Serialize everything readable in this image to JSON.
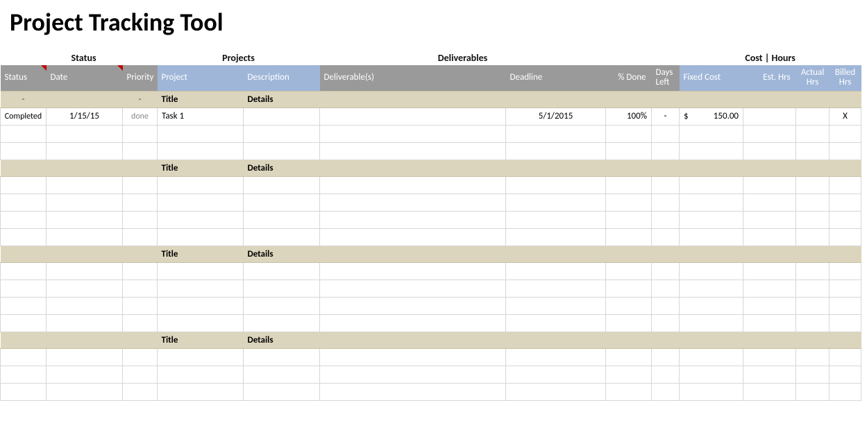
{
  "title": "Project Tracking Tool",
  "groups": {
    "status": "Status",
    "projects": "Projects",
    "deliverables": "Deliverables",
    "cost_hours": "Cost | Hours"
  },
  "columns": {
    "status": "Status",
    "date": "Date",
    "priority": "Priority",
    "project": "Project",
    "description": "Description",
    "deliverable": "Deliverable(s)",
    "deadline": "Deadline",
    "pct_done": "% Done",
    "days_left": "Days Left",
    "fixed_cost": "Fixed Cost",
    "est_hrs": "Est. Hrs",
    "actual_hrs": "Actual Hrs",
    "billed_hrs": "Billed Hrs"
  },
  "section_labels": {
    "title": "Title",
    "details": "Details",
    "dash": "-"
  },
  "sections": [
    {
      "show_dashes": true,
      "rows": [
        {
          "status": "Completed",
          "date": "1/15/15",
          "priority": "done",
          "project": "Task 1",
          "description": "",
          "deliverable": "",
          "deadline": "5/1/2015",
          "pct_done": "100%",
          "days_left": "-",
          "fixed_cost_currency": "$",
          "fixed_cost_value": "150.00",
          "est_hrs": "",
          "actual_hrs": "",
          "billed_hrs": "X"
        },
        {},
        {}
      ]
    },
    {
      "show_dashes": false,
      "rows": [
        {},
        {},
        {},
        {}
      ]
    },
    {
      "show_dashes": false,
      "rows": [
        {},
        {},
        {},
        {}
      ]
    },
    {
      "show_dashes": false,
      "rows": [
        {},
        {},
        {}
      ]
    }
  ]
}
